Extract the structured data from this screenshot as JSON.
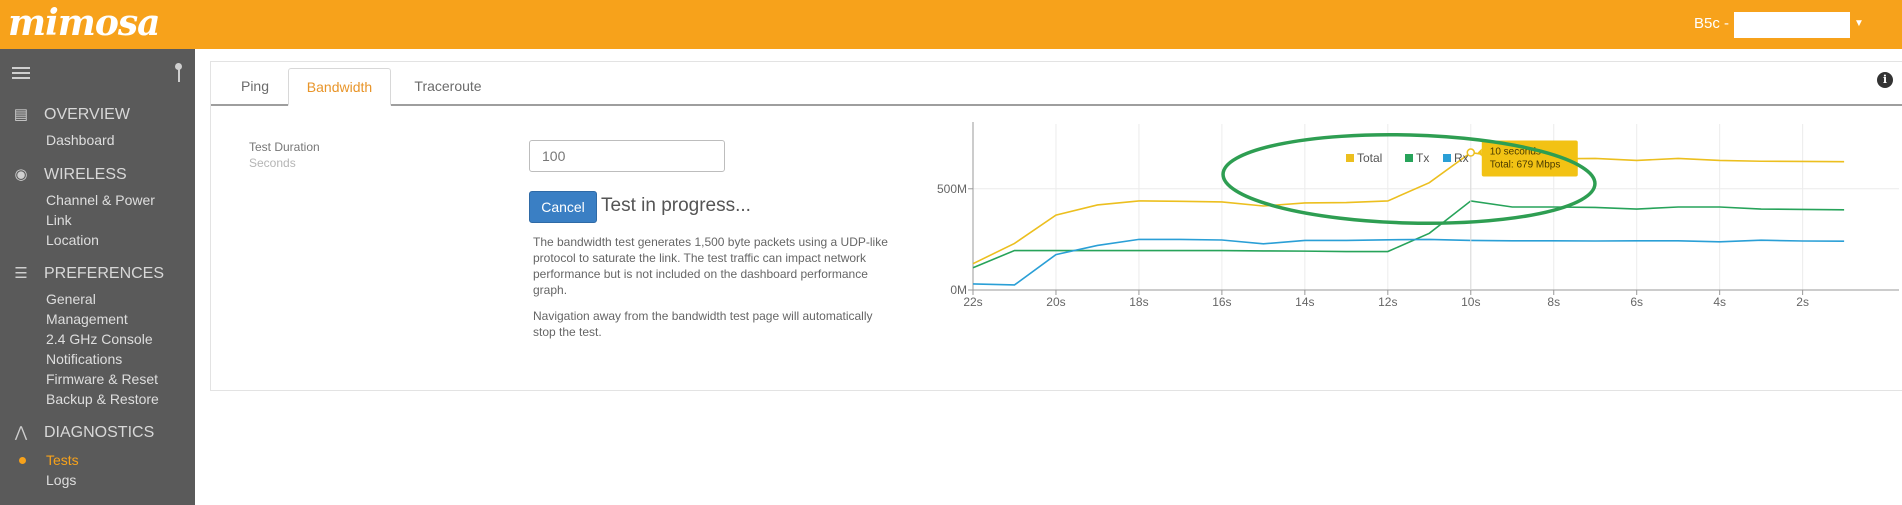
{
  "app": {
    "logo": "mimosa",
    "device_label": "B5c - F",
    "accent_color": "#f7a21b"
  },
  "sidebar": {
    "sections": [
      {
        "title": "OVERVIEW",
        "icon": "overview-icon",
        "items": [
          "Dashboard"
        ]
      },
      {
        "title": "WIRELESS",
        "icon": "wireless-icon",
        "items": [
          "Channel & Power",
          "Link",
          "Location"
        ]
      },
      {
        "title": "PREFERENCES",
        "icon": "preferences-icon",
        "items": [
          "General",
          "Management",
          "2.4 GHz Console",
          "Notifications",
          "Firmware & Reset",
          "Backup & Restore"
        ]
      },
      {
        "title": "DIAGNOSTICS",
        "icon": "diagnostics-icon",
        "items": [
          "Tests",
          "Logs"
        ]
      }
    ],
    "active_item": "Tests"
  },
  "tabs": [
    {
      "label": "Ping",
      "active": false
    },
    {
      "label": "Bandwidth",
      "active": true
    },
    {
      "label": "Traceroute",
      "active": false
    }
  ],
  "form": {
    "duration_label": "Test Duration",
    "duration_unit": "Seconds",
    "duration_value": "100",
    "cancel_label": "Cancel",
    "status_text": "Test in progress...",
    "description": "The bandwidth test generates 1,500 byte packets using a UDP-like protocol to saturate the link. The test traffic can impact network performance but is not included on the dashboard performance graph.",
    "navigation_note": "Navigation away from the bandwidth test page will automatically stop the test."
  },
  "chart_data": {
    "type": "line",
    "x_labels": [
      "22s",
      "20s",
      "18s",
      "16s",
      "14s",
      "12s",
      "10s",
      "8s",
      "6s",
      "4s",
      "2s"
    ],
    "x": [
      22,
      21,
      20,
      19,
      18,
      17,
      16,
      15,
      14,
      13,
      12,
      11,
      10,
      9,
      8,
      7,
      6,
      5,
      4,
      3,
      2,
      1
    ],
    "y_ticks": [
      "0M",
      "500M"
    ],
    "ylim": [
      0,
      820
    ],
    "series": [
      {
        "name": "Total",
        "color": "#ecbf1f",
        "values": [
          130,
          230,
          370,
          420,
          440,
          438,
          435,
          415,
          430,
          432,
          440,
          530,
          679,
          650,
          648,
          650,
          640,
          650,
          640,
          636,
          635,
          634
        ]
      },
      {
        "name": "Tx",
        "color": "#27a35a",
        "values": [
          110,
          195,
          195,
          195,
          195,
          195,
          195,
          193,
          192,
          190,
          190,
          280,
          440,
          410,
          410,
          408,
          400,
          410,
          410,
          400,
          398,
          396
        ]
      },
      {
        "name": "Rx",
        "color": "#2a9fd6",
        "values": [
          30,
          25,
          175,
          220,
          250,
          250,
          247,
          228,
          245,
          245,
          248,
          250,
          245,
          243,
          243,
          242,
          243,
          243,
          238,
          246,
          242,
          241
        ]
      }
    ],
    "tooltip": {
      "title": "10 seconds",
      "text": "Total: 679 Mbps"
    }
  }
}
